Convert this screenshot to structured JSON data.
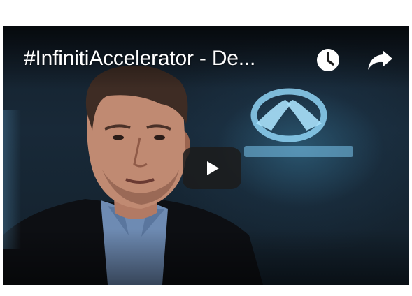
{
  "video": {
    "title": "#InfinitiAccelerator - De...",
    "controls": {
      "watch_later_icon": "clock-icon",
      "share_icon": "share-arrow-icon",
      "play_icon": "play-icon"
    },
    "colors": {
      "play_button_bg": "#1c1c1c",
      "logo_glow": "#8fd3f5",
      "title_text": "#ffffff"
    }
  }
}
